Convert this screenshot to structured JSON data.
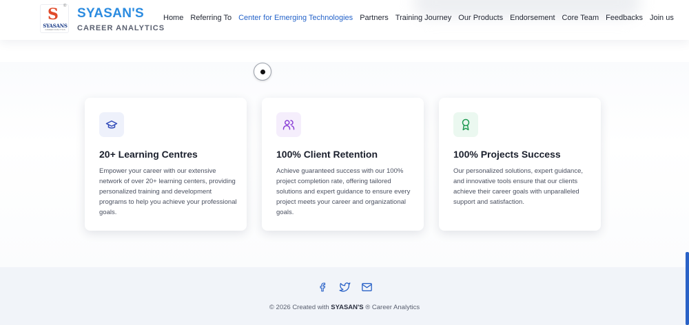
{
  "header": {
    "logo_letter": "S",
    "logo_word": "SYASANS",
    "logo_sub": "CAREER ANALYTICS",
    "logo_reg": "®",
    "brand_name": "SYASAN'S",
    "brand_sub": "CAREER ANALYTICS"
  },
  "nav": {
    "items": [
      {
        "label": "Home"
      },
      {
        "label": "Referring To"
      },
      {
        "label": "Center for Emerging Technologies"
      },
      {
        "label": "Partners"
      },
      {
        "label": "Training Journey"
      },
      {
        "label": "Our Products"
      },
      {
        "label": "Endorsement"
      },
      {
        "label": "Core Team"
      },
      {
        "label": "Feedbacks"
      },
      {
        "label": "Join us"
      }
    ],
    "active_index": 2
  },
  "cards": [
    {
      "icon": "graduation-cap-icon",
      "title": "20+ Learning Centres",
      "text": "Empower your career with our extensive network of over 20+ learning centers, providing personalized training and development programs to help you achieve your professional goals."
    },
    {
      "icon": "users-icon",
      "title": "100% Client Retention",
      "text": "Achieve guaranteed success with our 100% project completion rate, offering tailored solutions and expert guidance to ensure every project meets your career and organizational goals."
    },
    {
      "icon": "award-icon",
      "title": "100% Projects Success",
      "text": "Our personalized solutions, expert guidance, and innovative tools ensure that our clients achieve their career goals with unparalleled support and satisfaction."
    }
  ],
  "footer": {
    "social": [
      "facebook-icon",
      "twitter-icon",
      "mail-icon"
    ],
    "copyright_prefix": "© 2026 Created with",
    "copyright_brand": "SYASAN'S",
    "copyright_mark": "®",
    "copyright_suffix": "Career Analytics"
  },
  "colors": {
    "brand_blue": "#2b8be0",
    "nav_active": "#2563c9",
    "card1_icon_bg": "#eef1fb",
    "card1_icon": "#2f49b8",
    "card2_icon_bg": "#f5eefc",
    "card2_icon": "#8a3fd6",
    "card3_icon_bg": "#ebf8f0",
    "card3_icon": "#1f9a52",
    "footer_icon": "#2a62c7"
  }
}
